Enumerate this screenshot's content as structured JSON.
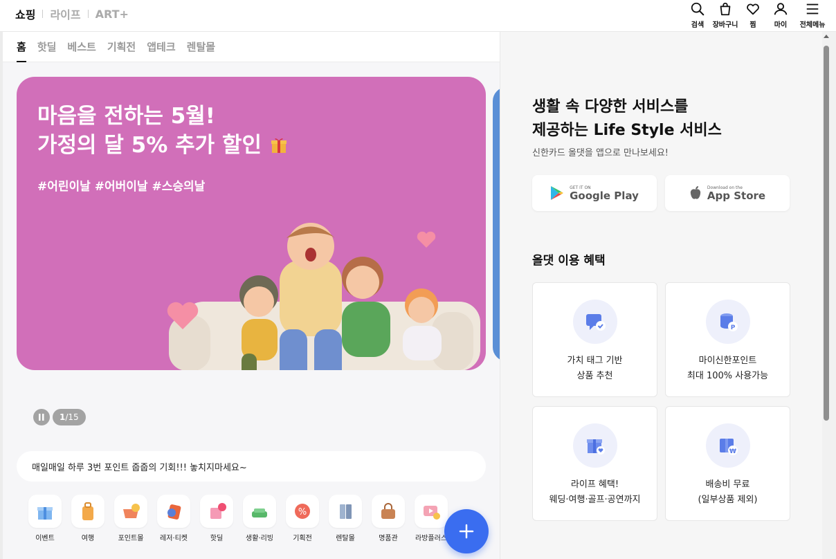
{
  "brand_tabs": [
    {
      "label": "쇼핑"
    },
    {
      "label": "라이프"
    },
    {
      "label": "ART+"
    }
  ],
  "header_actions": {
    "search": "검색",
    "cart": "장바구니",
    "wish": "찜",
    "my": "마이",
    "menu": "전체메뉴"
  },
  "subnav": [
    "홈",
    "핫딜",
    "베스트",
    "기획전",
    "앱테크",
    "렌탈몰"
  ],
  "banner": {
    "title_line1": "마음을 전하는 5월!",
    "title_line2": "가정의 달 5% 추가 할인",
    "tags": "#어린이날 #어버이날 #스승의날",
    "page": "1",
    "total": "/15",
    "bg_color": "#d16fb9"
  },
  "notice": "매일매일 하루 3번 포인트 줍줍의 기회!!! 놓치지마세요~",
  "categories": [
    {
      "label": "이벤트",
      "icon": "gift-icon"
    },
    {
      "label": "여행",
      "icon": "suitcase-icon"
    },
    {
      "label": "포인트몰",
      "icon": "point-basket-icon"
    },
    {
      "label": "레저·티켓",
      "icon": "ticket-icon"
    },
    {
      "label": "핫딜",
      "icon": "shopping-bag-new-icon"
    },
    {
      "label": "생활·리빙",
      "icon": "sofa-icon"
    },
    {
      "label": "기획전",
      "icon": "percent-badge-icon"
    },
    {
      "label": "렌탈몰",
      "icon": "fridge-icon"
    },
    {
      "label": "명품관",
      "icon": "handbag-icon"
    },
    {
      "label": "라방플러스",
      "icon": "live-video-icon"
    }
  ],
  "right": {
    "title_line1": "생활 속 다양한 서비스를",
    "title_line2": "제공하는 Life Style 서비스",
    "subtitle": "신한카드 올댓을 앱으로 만나보세요!",
    "google_small": "GET IT ON",
    "google_big": "Google Play",
    "apple_small": "Download on the",
    "apple_big": "App Store",
    "benefit_heading": "올댓 이용 혜택",
    "cards": [
      {
        "line1": "가치 태그 기반",
        "line2": "상품 추천",
        "icon": "chat-check-icon"
      },
      {
        "line1": "마이신한포인트",
        "line2": "최대 100% 사용가능",
        "icon": "coin-stack-icon"
      },
      {
        "line1": "라이프 혜택!",
        "line2": "웨딩·여행·골프·공연까지",
        "icon": "gift-heart-icon"
      },
      {
        "line1": "배송비 무료",
        "line2": "(일부상품 제외)",
        "icon": "box-won-icon"
      }
    ]
  },
  "colors": {
    "accent": "#3a6df0",
    "card_icon_bg": "#eef0fb",
    "icon_blue": "#5b7de8"
  }
}
